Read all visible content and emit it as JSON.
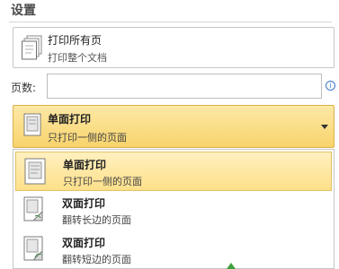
{
  "section": {
    "title": "设置"
  },
  "print_scope": {
    "title": "打印所有页",
    "subtitle": "打印整个文档",
    "icon": "document-pages-icon"
  },
  "pages": {
    "label": "页数:",
    "value": "",
    "info_icon": "info-icon"
  },
  "print_sides": {
    "title": "单面打印",
    "subtitle": "只打印一侧的页面",
    "icon": "single-sided-icon"
  },
  "menu": {
    "items": [
      {
        "title": "单面打印",
        "subtitle": "只打印一侧的页面",
        "icon": "single-sided-icon",
        "selected": true
      },
      {
        "title": "双面打印",
        "subtitle": "翻转长边的页面",
        "icon": "duplex-long-edge-icon",
        "selected": false
      },
      {
        "title": "双面打印",
        "subtitle": "翻转短边的页面",
        "icon": "duplex-short-edge-icon",
        "selected": false
      }
    ]
  },
  "colors": {
    "selection_top": "#fff0bf",
    "selection_bottom": "#fde08a",
    "selection_border": "#e3c061",
    "info": "#3b79c9"
  }
}
